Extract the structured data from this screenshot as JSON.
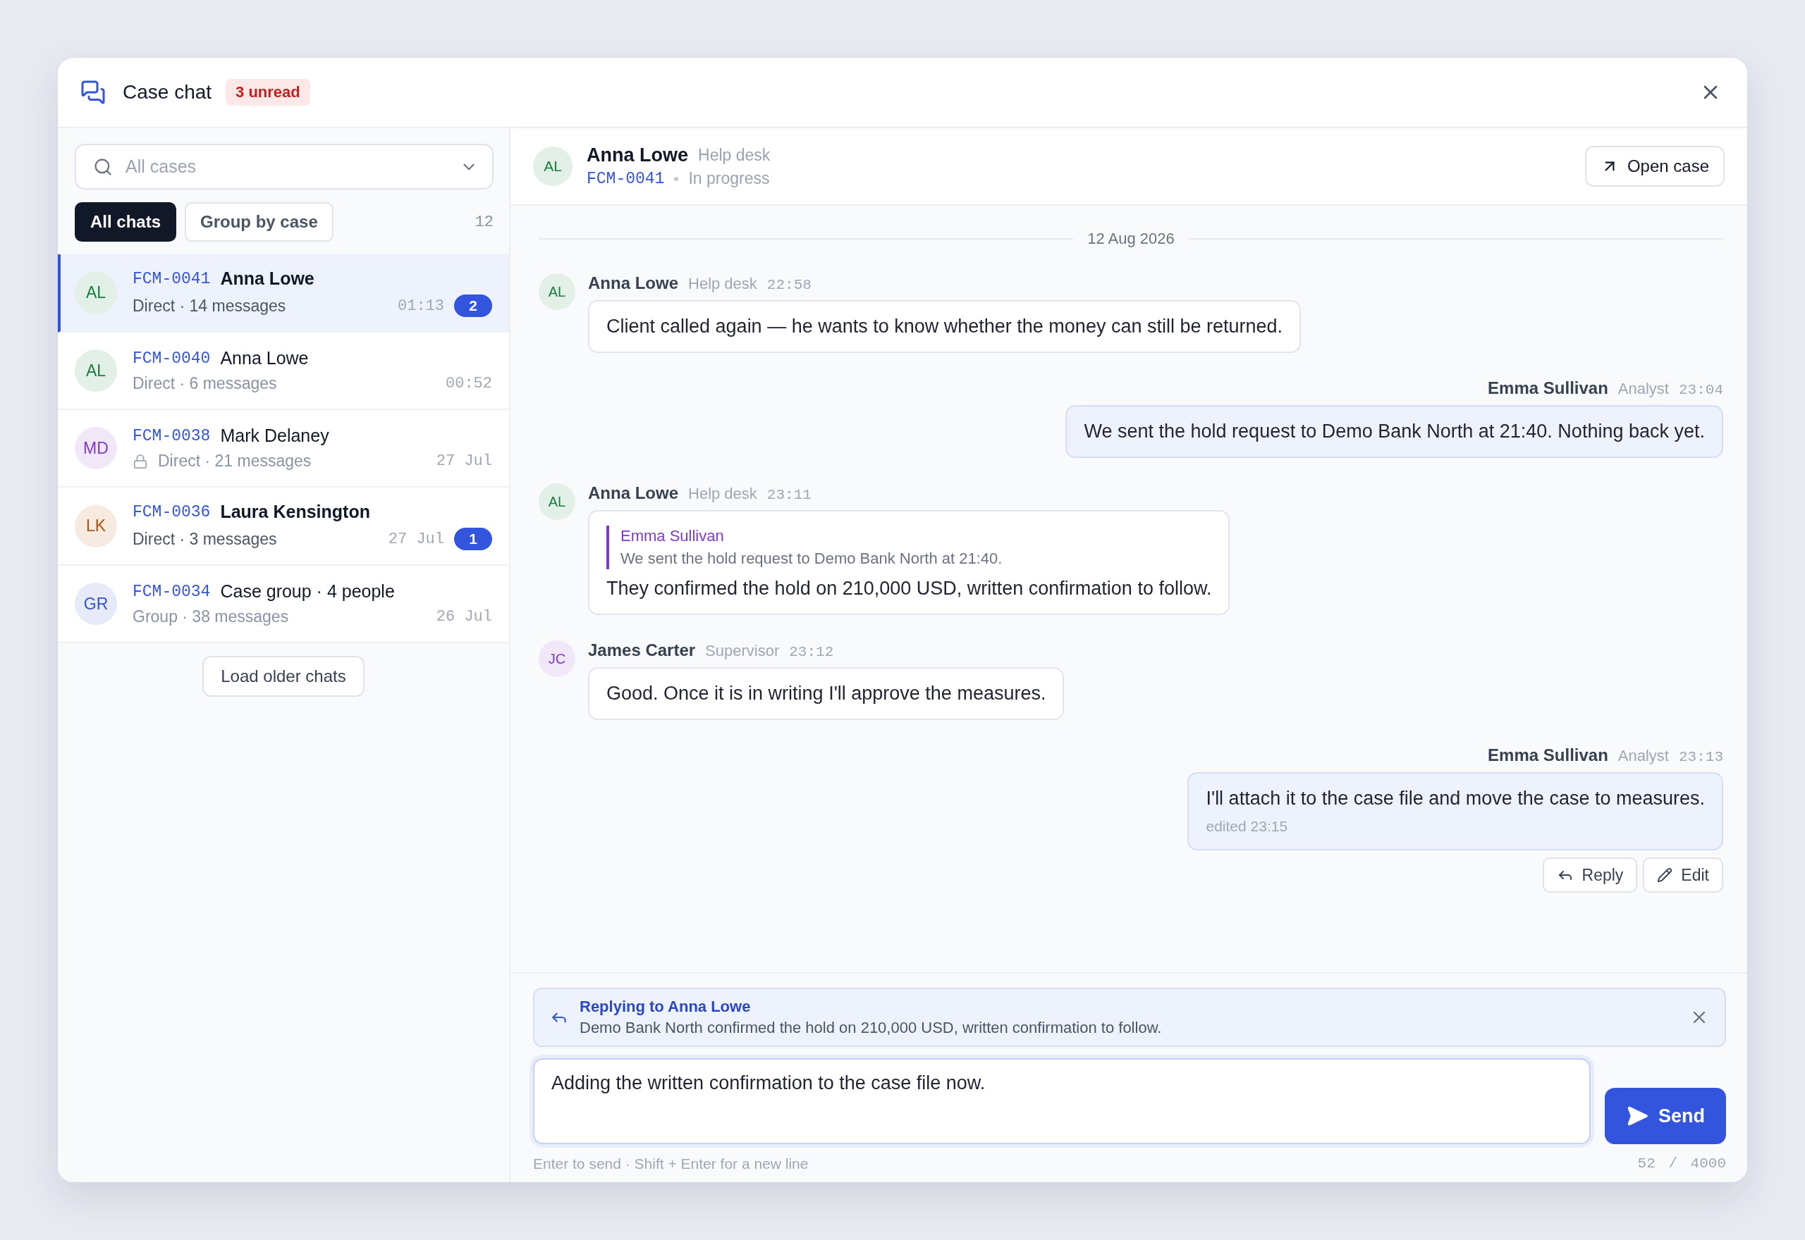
{
  "header": {
    "title": "Case chat",
    "unread_badge": "3 unread"
  },
  "sidebar": {
    "case_filter": {
      "placeholder": "All cases"
    },
    "view_tabs": [
      {
        "label": "All chats",
        "selected": true
      },
      {
        "label": "Group by case",
        "selected": false
      }
    ],
    "count": "12",
    "chats": [
      {
        "case": "FCM-0041",
        "title": "Anna Lowe",
        "subtitle": "Direct · 14 messages",
        "time": "01:13",
        "unread": "2",
        "locked": false,
        "selected": true,
        "avatar": {
          "initials": "AL",
          "color": "#15803d"
        }
      },
      {
        "case": "FCM-0040",
        "title": "Anna Lowe",
        "subtitle": "Direct · 6 messages",
        "time": "00:52",
        "locked": false,
        "selected": false,
        "avatar": {
          "initials": "AL",
          "color": "#15803d"
        }
      },
      {
        "case": "FCM-0038",
        "title": "Mark Delaney",
        "subtitle": "Direct · 21 messages",
        "time": "27 Jul",
        "locked": true,
        "selected": false,
        "avatar": {
          "initials": "MD",
          "color": "#7e3bc9"
        }
      },
      {
        "case": "FCM-0036",
        "title": "Laura Kensington",
        "subtitle": "Direct · 3 messages",
        "time": "27 Jul",
        "unread": "1",
        "locked": false,
        "selected": false,
        "avatar": {
          "initials": "LK",
          "color": "#b45309"
        }
      },
      {
        "case": "FCM-0034",
        "title": "Case group · 4 people",
        "subtitle": "Group · 38 messages",
        "time": "26 Jul",
        "locked": false,
        "selected": false,
        "avatar": {
          "initials": "GR",
          "color": "#3355cc"
        }
      }
    ],
    "load_more": "Load older chats"
  },
  "conversation": {
    "contact": {
      "initials": "AL",
      "color": "#15803d",
      "name": "Anna Lowe",
      "role": "Help desk",
      "case": "FCM-0041",
      "status": "In progress"
    },
    "open_case": "Open case",
    "date": "12 Aug 2026",
    "messages": [
      {
        "kind": "incoming",
        "author": "Anna Lowe",
        "role": "Help desk",
        "time": "22:58",
        "text": "Client called again — he wants to know whether the money can still be returned.",
        "avatar": {
          "initials": "AL",
          "color": "#15803d"
        }
      },
      {
        "kind": "outgoing",
        "author": "Emma Sullivan",
        "role": "Analyst",
        "time": "23:04",
        "text": "We sent the hold request to Demo Bank North at 21:40. Nothing back yet."
      },
      {
        "kind": "incoming",
        "author": "Anna Lowe",
        "role": "Help desk",
        "time": "23:11",
        "text": "They confirmed the hold on 210,000 USD, written confirmation to follow.",
        "avatar": {
          "initials": "AL",
          "color": "#15803d"
        },
        "quote": {
          "author": "Emma Sullivan",
          "text": "We sent the hold request to Demo Bank North at 21:40."
        }
      },
      {
        "kind": "incoming",
        "author": "James Carter",
        "role": "Supervisor",
        "time": "23:12",
        "text": "Good. Once it is in writing I'll approve the measures.",
        "avatar": {
          "initials": "JC",
          "color": "#7e3bc9"
        }
      },
      {
        "kind": "outgoing",
        "author": "Emma Sullivan",
        "role": "Analyst",
        "time": "23:13",
        "text": "I'll attach it to the case file and move the case to measures.",
        "edited": "edited 23:15",
        "actions": [
          {
            "kind": "reply",
            "label": "Reply"
          },
          {
            "kind": "edit",
            "label": "Edit"
          }
        ]
      }
    ]
  },
  "composer": {
    "reply": {
      "title": "Replying to Anna Lowe",
      "text": "Demo Bank North confirmed the hold on 210,000 USD, written confirmation to follow."
    },
    "value": "Adding the written confirmation to the case file now.",
    "send": "Send",
    "hint": "Enter to send · Shift + Enter for a new line",
    "counter": "52 / 4000"
  }
}
